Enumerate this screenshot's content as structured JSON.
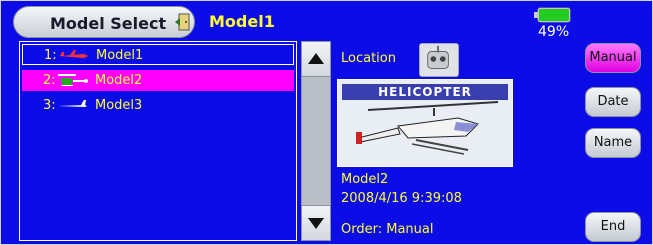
{
  "header": {
    "title": "Model Select",
    "current_model": "Model1",
    "battery_percent": "49%",
    "battery_level": 0.49
  },
  "model_list": [
    {
      "number": "1:",
      "name": "Model1",
      "icon": "airplane-icon",
      "selected": false,
      "focused": true
    },
    {
      "number": "2:",
      "name": "Model2",
      "icon": "helicopter-icon",
      "selected": true,
      "focused": false
    },
    {
      "number": "3:",
      "name": "Model3",
      "icon": "glider-icon",
      "selected": false,
      "focused": false
    }
  ],
  "details": {
    "location_label": "Location",
    "location_icon": "transmitter-icon",
    "thumbnail_banner": "HELICOPTER",
    "model_name": "Model2",
    "date": "2008/4/16  9:39:08",
    "order": "Order: Manual"
  },
  "buttons": {
    "manual": "Manual",
    "date": "Date",
    "name": "Name",
    "end": "End"
  },
  "colors": {
    "background": "#0c0ce6",
    "text": "#ffff33",
    "selected_row": "#ff00ff",
    "active_button": "#ff44ff"
  }
}
